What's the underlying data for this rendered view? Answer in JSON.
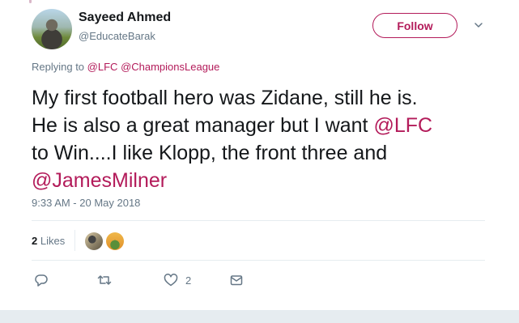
{
  "user": {
    "name": "Sayeed Ahmed",
    "handle": "@EducateBarak"
  },
  "follow_label": "Follow",
  "replying": {
    "prefix": "Replying to",
    "mentions": [
      "@LFC",
      "@ChampionsLeague"
    ]
  },
  "tweet": {
    "line1": "My first football hero was Zidane, still he is.",
    "line2_pre": "He is also a great manager but I want ",
    "line2_link": "@LFC",
    "line3": "to Win....I like Klopp, the front three and",
    "line4_link": "@JamesMilner"
  },
  "timestamp": "9:33 AM - 20 May 2018",
  "likes": {
    "count": "2",
    "label": "Likes"
  },
  "actions": {
    "reply_icon": "reply-icon",
    "retweet_icon": "retweet-icon",
    "like_icon": "heart-icon",
    "like_count": "2",
    "dm_icon": "envelope-icon"
  },
  "colors": {
    "accent": "#b31b5a",
    "muted": "#657786",
    "text": "#14171a",
    "divider": "#e6ecf0"
  }
}
